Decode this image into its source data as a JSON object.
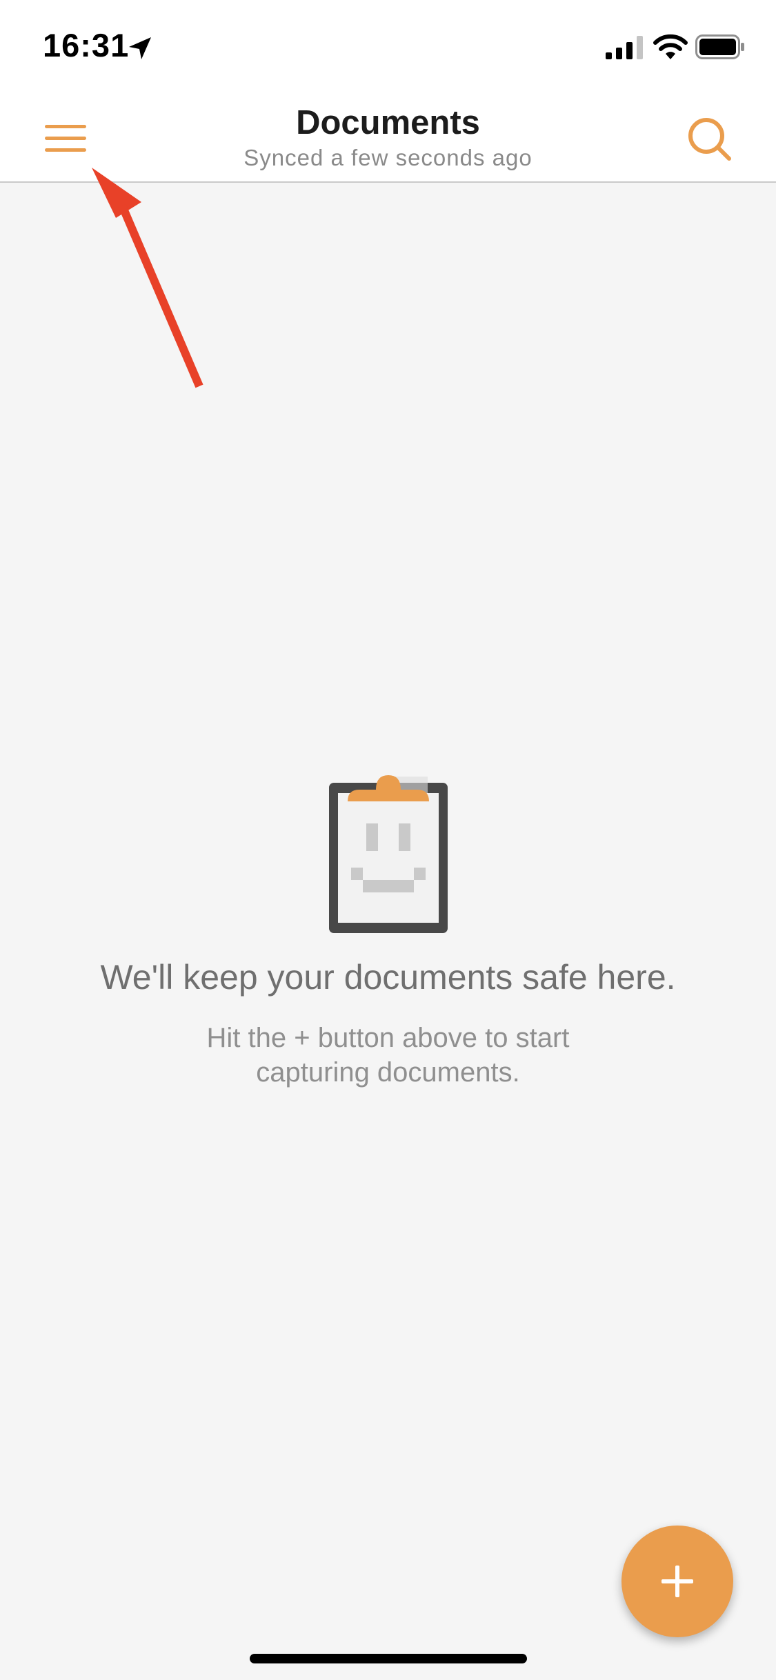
{
  "status_bar": {
    "time": "16:31",
    "icons": [
      "location-arrow-icon",
      "cellular-signal-icon",
      "wifi-icon",
      "battery-icon"
    ]
  },
  "nav": {
    "title": "Documents",
    "subtitle": "Synced a few seconds ago",
    "left_icon": "hamburger-menu-icon",
    "right_icon": "search-icon"
  },
  "empty_state": {
    "icon": "clipboard-smiley-icon",
    "title": "We'll keep your documents safe here.",
    "subtitle_line1": "Hit the + button above to start",
    "subtitle_line2": "capturing documents."
  },
  "fab": {
    "icon": "plus-icon"
  },
  "annotation": {
    "icon": "red-arrow-pointer"
  },
  "colors": {
    "accent": "#ea9d4d",
    "arrow": "#e84128",
    "background": "#f5f5f5",
    "clipboard_frame": "#484848"
  }
}
